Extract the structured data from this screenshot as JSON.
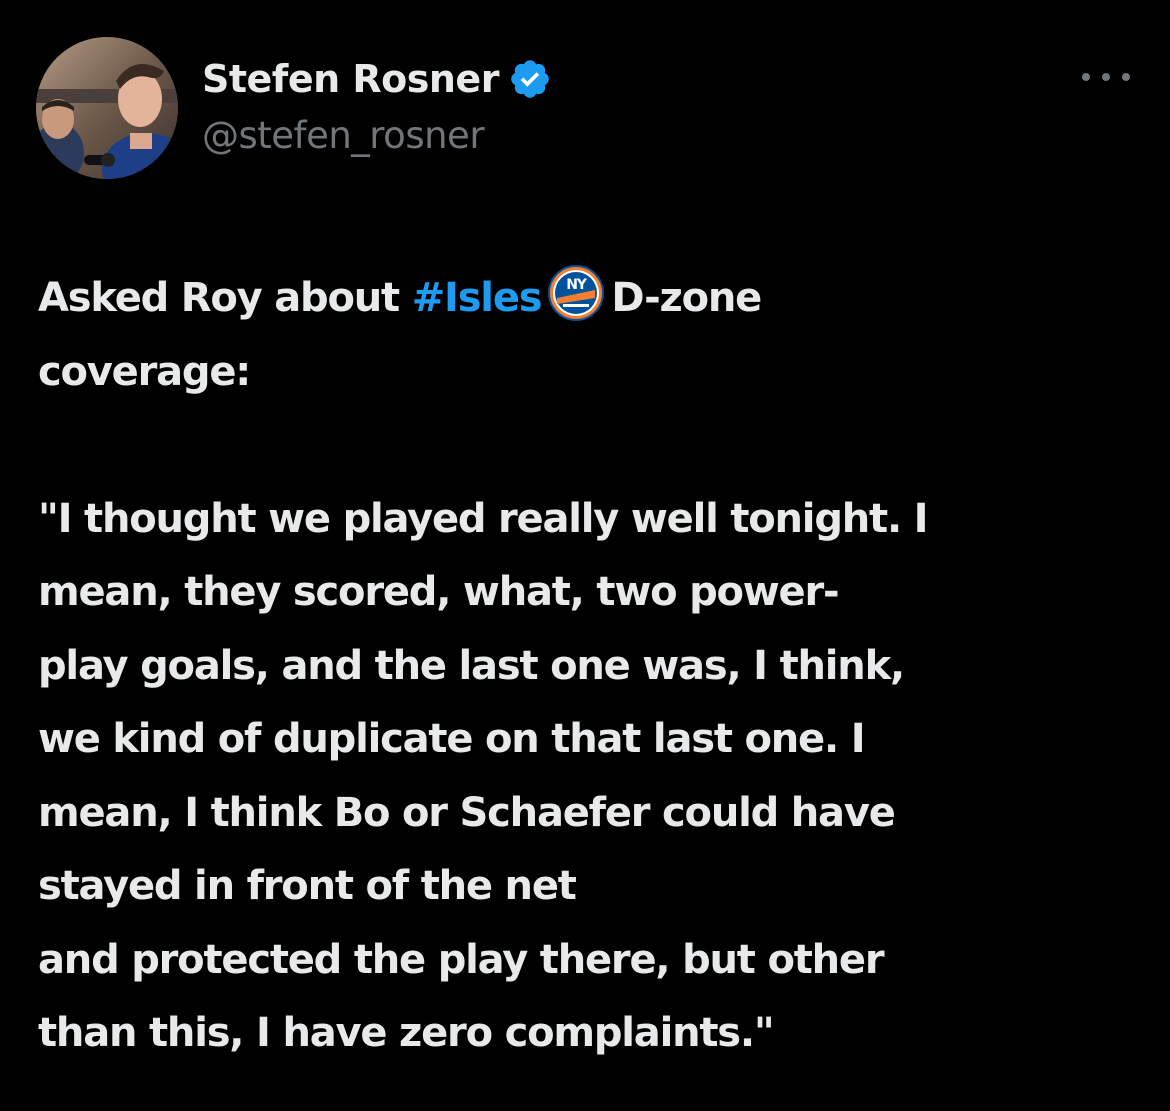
{
  "author": {
    "display_name": "Stefen Rosner",
    "handle": "@stefen_rosner",
    "verified_color": "#1d9bf0"
  },
  "icons": {
    "verified": "verified-badge-icon",
    "more": "more-options-icon",
    "team_logo": "ny-islanders-logo-icon"
  },
  "colors": {
    "background": "#000000",
    "text": "#e7e9ea",
    "secondary_text": "#71767b",
    "link": "#1d9bf0"
  },
  "tweet": {
    "line1_prefix": "Asked Roy about ",
    "hashtag": "#Isles",
    "line1_suffix": "D-zone",
    "line2": "coverage:",
    "quote_lines": [
      "\"I thought we played really well tonight. I",
      "mean, they scored, what, two power-",
      "play goals, and the last one was, I think,",
      "we kind of duplicate on that last one. I",
      "mean, I think Bo or Schaefer could have",
      "stayed in front of the net",
      "and protected the play there, but other",
      "than this, I have zero complaints.\""
    ]
  }
}
